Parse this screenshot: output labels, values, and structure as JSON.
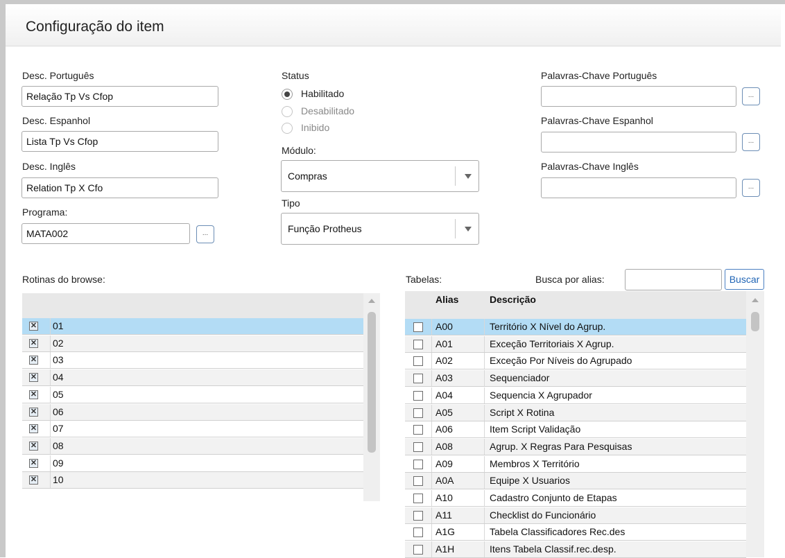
{
  "title": "Configuração do item",
  "form": {
    "desc_pt": {
      "label": "Desc. Português",
      "value": "Relação Tp Vs Cfop"
    },
    "desc_es": {
      "label": "Desc. Espanhol",
      "value": "Lista Tp Vs Cfop"
    },
    "desc_en": {
      "label": "Desc. Inglês",
      "value": "Relation Tp X Cfo"
    },
    "programa": {
      "label": "Programa:",
      "value": "MATA002",
      "lookup": "..."
    },
    "status": {
      "label": "Status",
      "options": [
        "Habilitado",
        "Desabilitado",
        "Inibido"
      ],
      "selected": "Habilitado"
    },
    "modulo": {
      "label": "Módulo:",
      "value": "Compras"
    },
    "tipo": {
      "label": "Tipo",
      "value": "Função Protheus"
    },
    "kw_pt": {
      "label": "Palavras-Chave Português",
      "value": "",
      "lookup": "..."
    },
    "kw_es": {
      "label": "Palavras-Chave Espanhol",
      "value": "",
      "lookup": "..."
    },
    "kw_en": {
      "label": "Palavras-Chave Inglês",
      "value": "",
      "lookup": "..."
    }
  },
  "rotinas": {
    "label": "Rotinas do browse:",
    "rows": [
      {
        "code": "01",
        "checked": true
      },
      {
        "code": "02",
        "checked": true
      },
      {
        "code": "03",
        "checked": true
      },
      {
        "code": "04",
        "checked": true
      },
      {
        "code": "05",
        "checked": true
      },
      {
        "code": "06",
        "checked": true
      },
      {
        "code": "07",
        "checked": true
      },
      {
        "code": "08",
        "checked": true
      },
      {
        "code": "09",
        "checked": true
      },
      {
        "code": "10",
        "checked": true
      }
    ],
    "selected_index": 0
  },
  "tabelas": {
    "label": "Tabelas:",
    "search_label": "Busca por alias:",
    "search_value": "",
    "search_button": "Buscar",
    "columns": [
      "Alias",
      "Descrição"
    ],
    "rows": [
      {
        "alias": "A00",
        "desc": "Território X Nível do Agrup."
      },
      {
        "alias": "A01",
        "desc": "Exceção Territoriais X Agrup."
      },
      {
        "alias": "A02",
        "desc": "Exceção Por Níveis do Agrupado"
      },
      {
        "alias": "A03",
        "desc": "Sequenciador"
      },
      {
        "alias": "A04",
        "desc": "Sequencia X Agrupador"
      },
      {
        "alias": "A05",
        "desc": "Script X Rotina"
      },
      {
        "alias": "A06",
        "desc": "Item Script Validação"
      },
      {
        "alias": "A08",
        "desc": "Agrup. X Regras Para Pesquisas"
      },
      {
        "alias": "A09",
        "desc": "Membros X Território"
      },
      {
        "alias": "A0A",
        "desc": "Equipe X Usuarios"
      },
      {
        "alias": "A10",
        "desc": "Cadastro Conjunto de Etapas"
      },
      {
        "alias": "A11",
        "desc": "Checklist do Funcionário"
      },
      {
        "alias": "A1G",
        "desc": "Tabela Classificadores Rec.des"
      },
      {
        "alias": "A1H",
        "desc": "Itens Tabela Classif.rec.desp."
      }
    ],
    "selected_index": 0
  },
  "colors": {
    "selected_row": "#b3dcf5",
    "alt_row": "#f2f2f2",
    "accent": "#1f64b5"
  }
}
